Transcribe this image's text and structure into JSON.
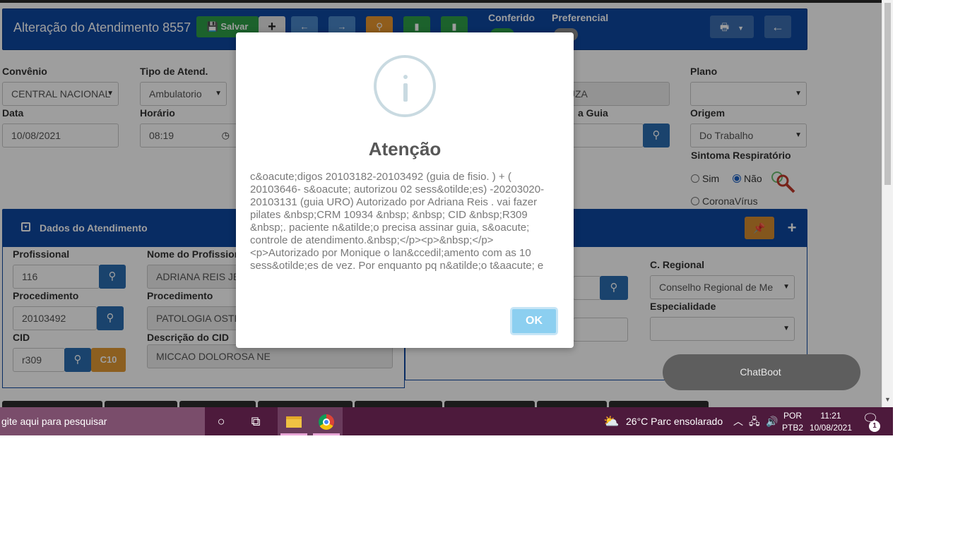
{
  "header": {
    "title": "Alteração do Atendimento 8557",
    "save_label": "Salvar",
    "plus_label": "+",
    "conferido_label": "Conferido",
    "preferencial_label": "Preferencial"
  },
  "form": {
    "convenio": {
      "label": "Convênio",
      "value": "CENTRAL NACIONAL"
    },
    "tipo_atend": {
      "label": "Tipo de Atend.",
      "value": "Ambulatorio"
    },
    "paciente_tail": {
      "value": "OUZA"
    },
    "plano": {
      "label": "Plano",
      "value": ""
    },
    "data": {
      "label": "Data",
      "value": "10/08/2021"
    },
    "horario": {
      "label": "Horário",
      "value": "08:19"
    },
    "guia_tail": {
      "label": "a Guia"
    },
    "origem": {
      "label": "Origem",
      "value": "Do Trabalho"
    },
    "sintoma": {
      "label": "Sintoma Respiratório",
      "sim": "Sim",
      "nao": "Não",
      "corona": "CoronaVírus",
      "selected": "nao"
    }
  },
  "panel": {
    "title": "Dados do Atendimento",
    "profissional": {
      "label": "Profissional",
      "value": "116"
    },
    "nome_profissional": {
      "label": "Nome do Profission",
      "value": "ADRIANA REIS JE"
    },
    "procedimento_cod": {
      "label": "Procedimento",
      "value": "20103492"
    },
    "procedimento_nome": {
      "label": "Procedimento",
      "value": "PATOLOGIA OSTE"
    },
    "cid": {
      "label": "CID",
      "value": "r309",
      "c10_label": "C10"
    },
    "descricao_cid": {
      "label": "Descrição do CID",
      "value": "MICCAO DOLOROSA NE"
    },
    "c_regional": {
      "label": "C. Regional",
      "value": "Conselho Regional de Me"
    },
    "especialidade": {
      "label": "Especialidade",
      "value": ""
    }
  },
  "chatboot": {
    "label": "ChatBoot"
  },
  "modal": {
    "title": "Atenção",
    "text": "c&oacute;digos 20103182-20103492 (guia de fisio. ) + ( 20103646- s&oacute; autorizou 02 sess&otilde;es) -20203020-20103131 (guia URO) Autorizado por Adriana Reis . vai fazer pilates &nbsp;CRM 10934 &nbsp; &nbsp; CID &nbsp;R309 &nbsp;. paciente n&atilde;o precisa assinar guia, s&oacute; controle de atendimento.&nbsp;</p><p>&nbsp;</p><p>Autorizado por Monique o lan&ccedil;amento com as 10 sess&otilde;es de vez. Por enquanto pq n&atilde;o t&aacute; e",
    "ok_label": "OK"
  },
  "taskbar": {
    "search_placeholder": "gite aqui para pesquisar",
    "weather": "26°C  Parc ensolarado",
    "lang_top": "POR",
    "lang_bottom": "PTB2",
    "time": "11:21",
    "date": "10/08/2021",
    "notifications": "1"
  },
  "colors": {
    "header_bg": "#0d47a1",
    "save_green": "#2e9e48",
    "search_blue": "#2a6db0",
    "ok_button": "#8ccff0",
    "taskbar_bg": "#4d1a3c"
  }
}
